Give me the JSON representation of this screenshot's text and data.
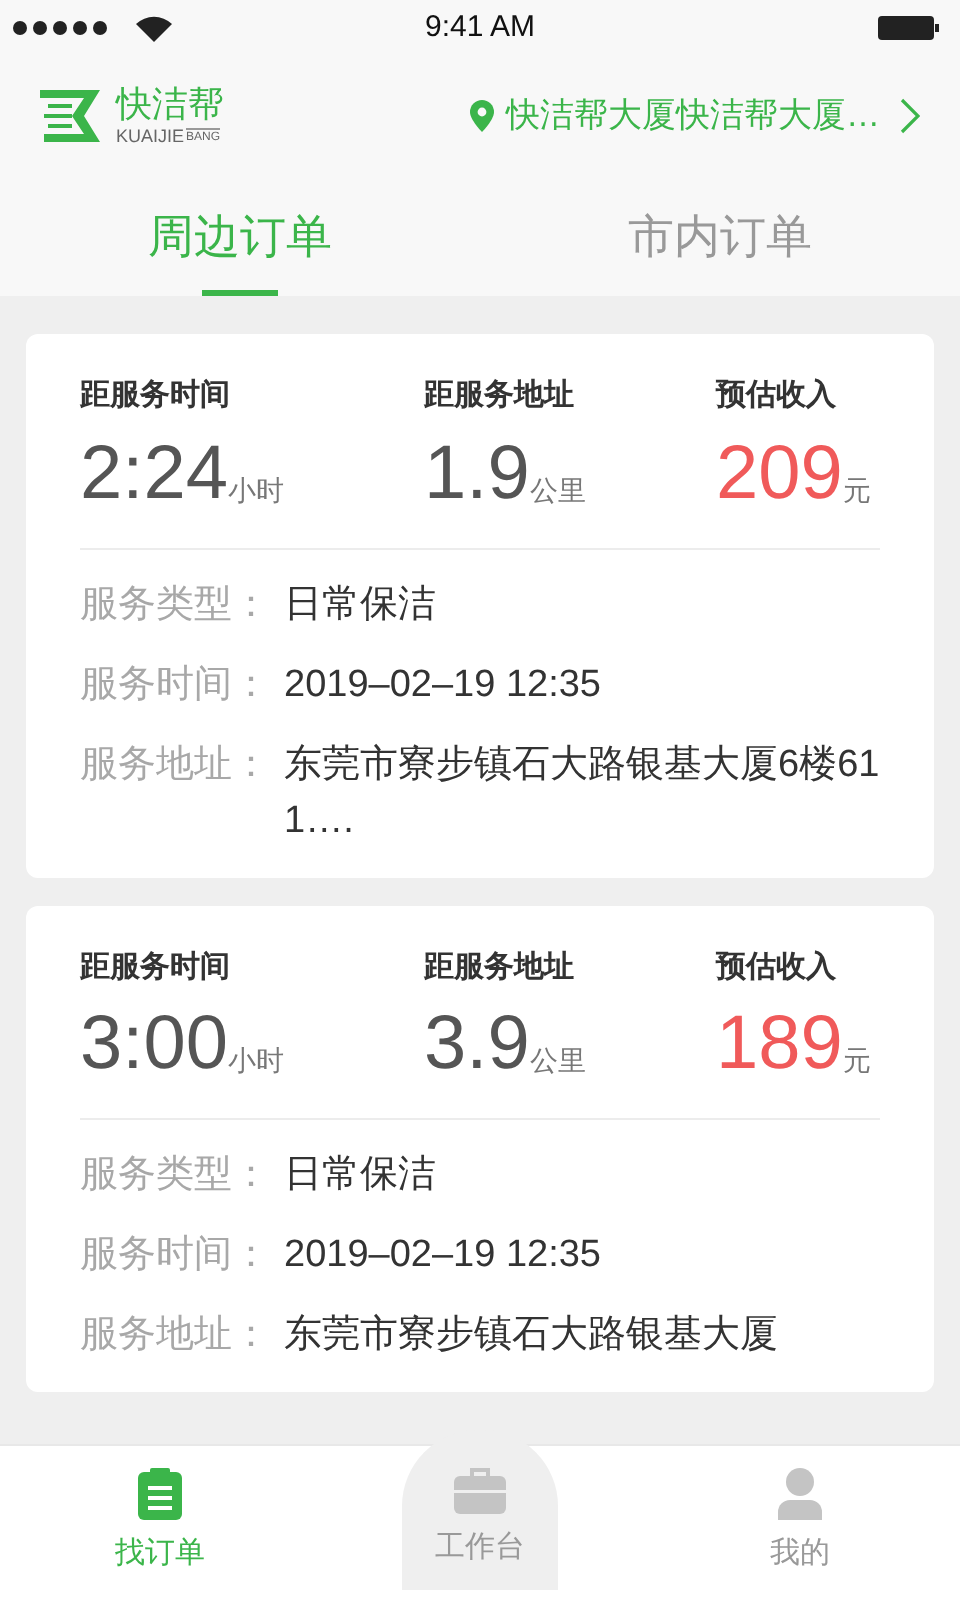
{
  "status_bar": {
    "time": "9:41 AM"
  },
  "header": {
    "logo_text": "快洁帮",
    "logo_subtext": "KUAIJIE",
    "logo_subtext_small": "BANG",
    "location": "快洁帮大厦快洁帮大厦…"
  },
  "tabs": [
    {
      "label": "周边订单",
      "selected": true
    },
    {
      "label": "市内订单",
      "selected": false
    }
  ],
  "orders": [
    {
      "stats": [
        {
          "label": "距服务时间",
          "value": "2:24",
          "unit": "小时",
          "accent": false
        },
        {
          "label": "距服务地址",
          "value": "1.9",
          "unit": "公里",
          "accent": false
        },
        {
          "label": "预估收入",
          "value": "209",
          "unit": "元",
          "accent": true
        }
      ],
      "details": [
        {
          "label": "服务类型：",
          "value": "日常保洁"
        },
        {
          "label": "服务时间：",
          "value": "2019–02–19   12:35"
        },
        {
          "label": "服务地址：",
          "value": "东莞市寮步镇石大路银基大厦6楼611…."
        }
      ]
    },
    {
      "stats": [
        {
          "label": "距服务时间",
          "value": "3:00",
          "unit": "小时",
          "accent": false
        },
        {
          "label": "距服务地址",
          "value": "3.9",
          "unit": "公里",
          "accent": false
        },
        {
          "label": "预估收入",
          "value": "189",
          "unit": "元",
          "accent": true
        }
      ],
      "details": [
        {
          "label": "服务类型：",
          "value": "日常保洁"
        },
        {
          "label": "服务时间：",
          "value": "2019–02–19   12:35"
        },
        {
          "label": "服务地址：",
          "value": "东莞市寮步镇石大路银基大厦"
        }
      ]
    }
  ],
  "bottom_nav": [
    {
      "label": "找订单",
      "kind": "clipboard",
      "selected": true,
      "raised": false
    },
    {
      "label": "工作台",
      "kind": "briefcase",
      "selected": false,
      "raised": true
    },
    {
      "label": "我的",
      "kind": "user",
      "selected": false,
      "raised": false
    }
  ]
}
